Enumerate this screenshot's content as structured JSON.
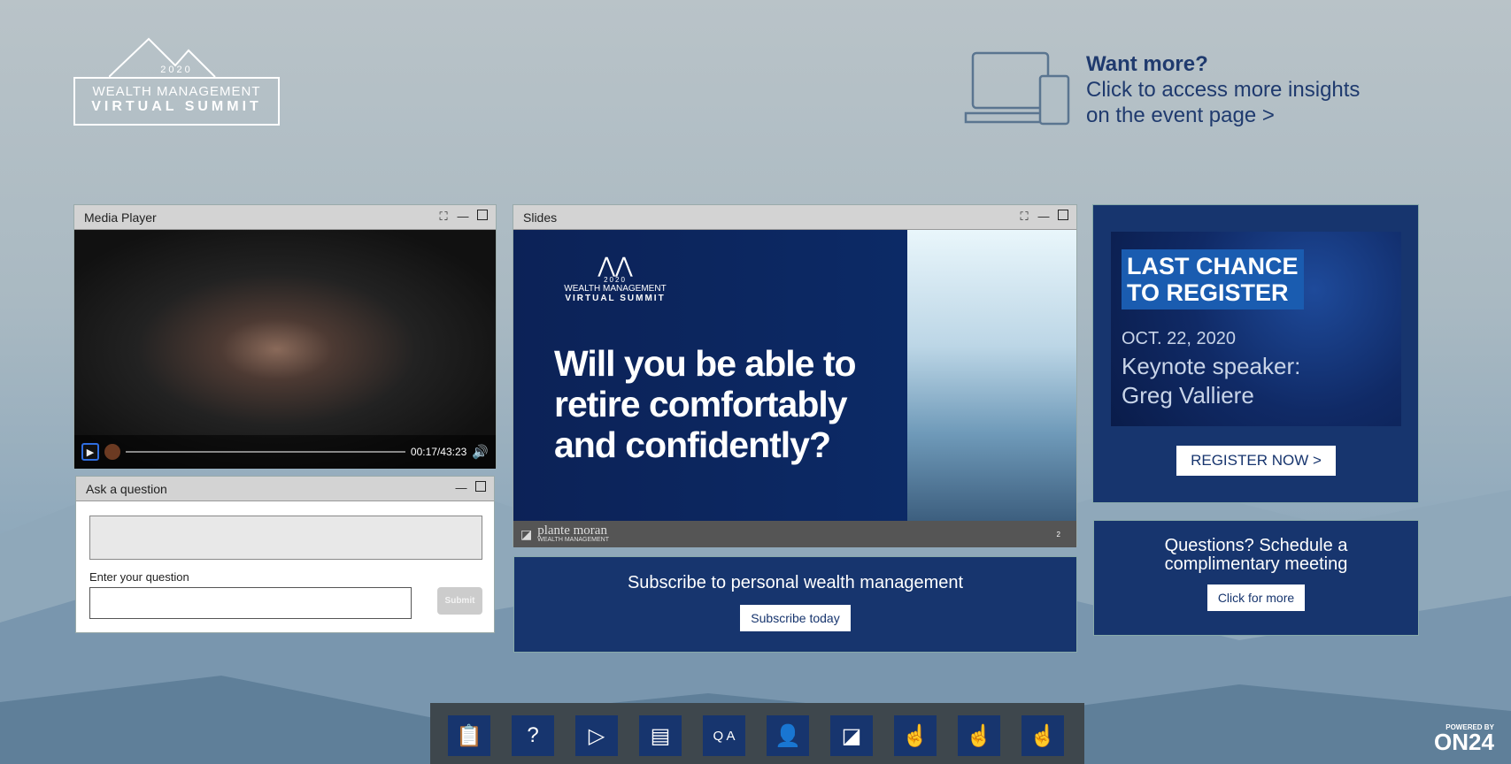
{
  "logo": {
    "year": "2020",
    "line1": "WEALTH MANAGEMENT",
    "line2": "VIRTUAL SUMMIT"
  },
  "promo": {
    "heading": "Want more?",
    "line1": "Click to access more insights",
    "line2": "on the event page  >",
    "icon": "laptop-phone-icon"
  },
  "media_player": {
    "title": "Media Player",
    "time": "00:17/43:23",
    "progress": 0.0065
  },
  "ask": {
    "title": "Ask a question",
    "label": "Enter your question",
    "input_value": "",
    "submit": "Submit"
  },
  "slides": {
    "title": "Slides",
    "logo_year": "2020",
    "logo_line1": "WEALTH MANAGEMENT",
    "logo_line2": "VIRTUAL SUMMIT",
    "question": "Will you be able to retire comfortably and confidently?",
    "footer_brand": "plante moran",
    "footer_sub": "WEALTH MANAGEMENT",
    "page": "2"
  },
  "subscribe": {
    "text": "Subscribe to personal wealth management",
    "button": "Subscribe today"
  },
  "register": {
    "line1": "LAST CHANCE",
    "line2": "TO REGISTER",
    "date": "OCT. 22, 2020",
    "speaker_label": "Keynote speaker:",
    "speaker": "Greg Valliere",
    "button": "REGISTER NOW >"
  },
  "meeting": {
    "text": "Questions? Schedule a complimentary meeting",
    "button": "Click for more"
  },
  "dock": {
    "icons": [
      "survey-icon",
      "help-icon",
      "play-icon",
      "slides-icon",
      "qa-icon",
      "speaker-icon",
      "plante-moran-icon",
      "touch-icon",
      "touch-icon",
      "touch-icon"
    ]
  },
  "powered": {
    "label": "POWERED BY",
    "brand": "ON24"
  },
  "colors": {
    "navy": "#17356e",
    "text_blue": "#1f3a6e",
    "dock": "#3e474d"
  }
}
